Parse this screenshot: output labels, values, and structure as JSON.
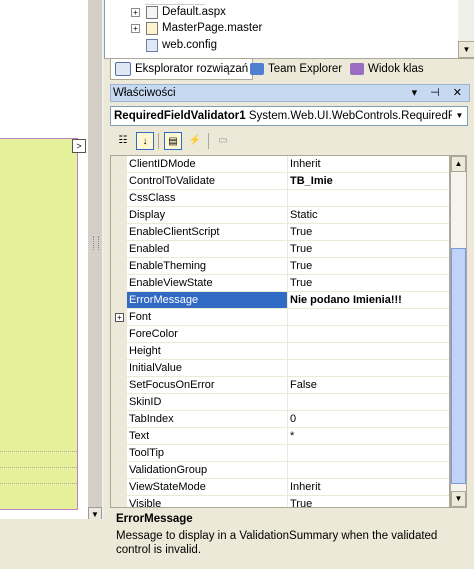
{
  "solution_tree": {
    "items": [
      {
        "label": "Default.aspx",
        "expander": "+"
      },
      {
        "label": "MasterPage.master",
        "expander": "+"
      },
      {
        "label": "web.config",
        "expander": ""
      }
    ]
  },
  "tabs": [
    {
      "label": "Eksplorator rozwiązań",
      "active": true
    },
    {
      "label": "Team Explorer",
      "active": false
    },
    {
      "label": "Widok klas",
      "active": false
    }
  ],
  "properties": {
    "title": "Właściwości",
    "window_controls": "▾ ⊣ ✕",
    "object_name": "RequiredFieldValidator1",
    "object_type": "System.Web.UI.WebControls.RequiredFi",
    "rows": [
      {
        "name": "ClientIDMode",
        "value": "Inherit",
        "bold": false,
        "expander": "",
        "selected": false
      },
      {
        "name": "ControlToValidate",
        "value": "TB_Imie",
        "bold": true,
        "expander": "",
        "selected": false
      },
      {
        "name": "CssClass",
        "value": "",
        "bold": false,
        "expander": "",
        "selected": false
      },
      {
        "name": "Display",
        "value": "Static",
        "bold": false,
        "expander": "",
        "selected": false
      },
      {
        "name": "EnableClientScript",
        "value": "True",
        "bold": false,
        "expander": "",
        "selected": false
      },
      {
        "name": "Enabled",
        "value": "True",
        "bold": false,
        "expander": "",
        "selected": false
      },
      {
        "name": "EnableTheming",
        "value": "True",
        "bold": false,
        "expander": "",
        "selected": false
      },
      {
        "name": "EnableViewState",
        "value": "True",
        "bold": false,
        "expander": "",
        "selected": false
      },
      {
        "name": "ErrorMessage",
        "value": "Nie podano Imienia!!!",
        "bold": true,
        "expander": "",
        "selected": true
      },
      {
        "name": "Font",
        "value": "",
        "bold": false,
        "expander": "+",
        "selected": false
      },
      {
        "name": "ForeColor",
        "value": "",
        "bold": false,
        "expander": "",
        "selected": false
      },
      {
        "name": "Height",
        "value": "",
        "bold": false,
        "expander": "",
        "selected": false
      },
      {
        "name": "InitialValue",
        "value": "",
        "bold": false,
        "expander": "",
        "selected": false
      },
      {
        "name": "SetFocusOnError",
        "value": "False",
        "bold": false,
        "expander": "",
        "selected": false
      },
      {
        "name": "SkinID",
        "value": "",
        "bold": false,
        "expander": "",
        "selected": false
      },
      {
        "name": "TabIndex",
        "value": "0",
        "bold": false,
        "expander": "",
        "selected": false
      },
      {
        "name": "Text",
        "value": "*",
        "bold": false,
        "expander": "",
        "selected": false
      },
      {
        "name": "ToolTip",
        "value": "",
        "bold": false,
        "expander": "",
        "selected": false
      },
      {
        "name": "ValidationGroup",
        "value": "",
        "bold": false,
        "expander": "",
        "selected": false
      },
      {
        "name": "ViewStateMode",
        "value": "Inherit",
        "bold": false,
        "expander": "",
        "selected": false
      },
      {
        "name": "Visible",
        "value": "True",
        "bold": false,
        "expander": "",
        "selected": false
      }
    ],
    "description_title": "ErrorMessage",
    "description_text": "Message to display in a ValidationSummary when the validated control is invalid."
  },
  "designer": {
    "smart_tag_glyph": ">",
    "scroll_down_glyph": "▼"
  },
  "colors": {
    "selected_row": "#316ac5",
    "designer_panel": "#e4f19a",
    "title_bar": "#c6d9f1"
  }
}
